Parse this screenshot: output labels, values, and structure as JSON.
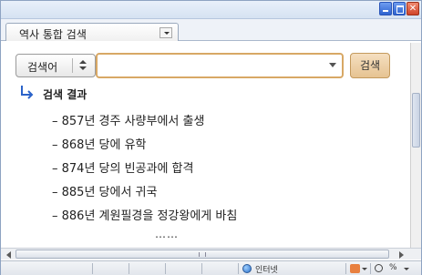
{
  "tab": {
    "title": "역사 통합 검색"
  },
  "search": {
    "category": "검색어",
    "query": "",
    "button_label": "검색"
  },
  "results": {
    "title": "검색 결과",
    "items": [
      "– 857년 경주 사량부에서 출생",
      "– 868년 당에 유학",
      "– 874년 당의 빈공과에 합격",
      "– 885년 당에서 귀국",
      "– 886년 계원필경을 정강왕에게 바침"
    ],
    "ellipsis": "……"
  },
  "statusbar": {
    "zone": "인터넷",
    "zoom": "%"
  },
  "colors": {
    "search_border": "#d8a865",
    "search_button": "#e6c392",
    "arrow": "#2b63c9"
  },
  "icons": [
    "minimize-icon",
    "maximize-icon",
    "close-icon",
    "dropdown-icon",
    "spin-icon",
    "arrow-return-icon",
    "globe-icon",
    "zoom-icon"
  ]
}
